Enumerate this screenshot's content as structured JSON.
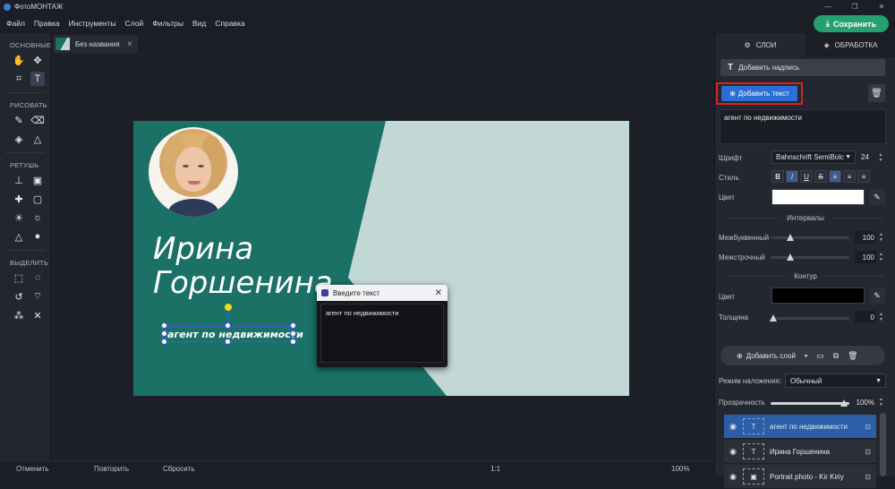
{
  "app": {
    "title": "ФотоМОНТАЖ"
  },
  "menu": [
    "Файл",
    "Правка",
    "Инструменты",
    "Слой",
    "Фильтры",
    "Вид",
    "Справка"
  ],
  "save_label": "Сохранить",
  "tools": {
    "sections": [
      "ОСНОВНЫЕ",
      "РИСОВАТЬ",
      "РЕТУШЬ",
      "ВЫДЕЛИТЬ"
    ]
  },
  "doc_tab": {
    "label": "Без названия",
    "close": "×"
  },
  "canvas": {
    "name_line1": "Ирина",
    "name_line2": "Горшенина",
    "selected_text": "агент по недвижимости"
  },
  "dialog": {
    "title": "Введите текст",
    "text": "агент по недвижимости"
  },
  "bottom": {
    "undo": "Отменить",
    "redo": "Повторить",
    "reset": "Сбросить",
    "ratio": "1:1",
    "zoom": "100%"
  },
  "panel": {
    "tab_layers": "СЛОИ",
    "tab_processing": "ОБРАБОТКА",
    "add_caption": "Добавить надпись",
    "add_text": "Добавить текст",
    "text_value": "агент по недвижимости",
    "font_label": "Шрифт",
    "font_value": "Bahnschrift SemiBolc",
    "font_size": "24",
    "style_label": "Стиль",
    "style_buttons": [
      "B",
      "I",
      "U",
      "S",
      "≡",
      "≡",
      "≡"
    ],
    "color_label": "Цвет",
    "text_color": "#ffffff",
    "intervals_label": "Интервалы",
    "letter_spacing_label": "Межбуквенный",
    "letter_spacing_value": "100",
    "line_spacing_label": "Межстрочный",
    "line_spacing_value": "100",
    "outline_label": "Контур",
    "outline_color_label": "Цвет",
    "outline_color": "#000000",
    "thickness_label": "Толщина",
    "thickness_value": "0",
    "add_layer": "Добавить слой",
    "blend_label": "Режим наложения:",
    "blend_value": "Обычный",
    "opacity_label": "Прозрачность",
    "opacity_value": "100%",
    "layers": [
      {
        "name": "агент по недвижимости",
        "selected": true
      },
      {
        "name": "Ирина Горшенина",
        "selected": false
      },
      {
        "name": "Portrait photo - Kir Kiriy",
        "selected": false
      }
    ]
  },
  "colors": {
    "accent": "#2a6fd6",
    "save": "#25a070",
    "canvas_dark": "#1b7166",
    "canvas_light": "#c2d8d5",
    "highlight": "#e02020"
  }
}
